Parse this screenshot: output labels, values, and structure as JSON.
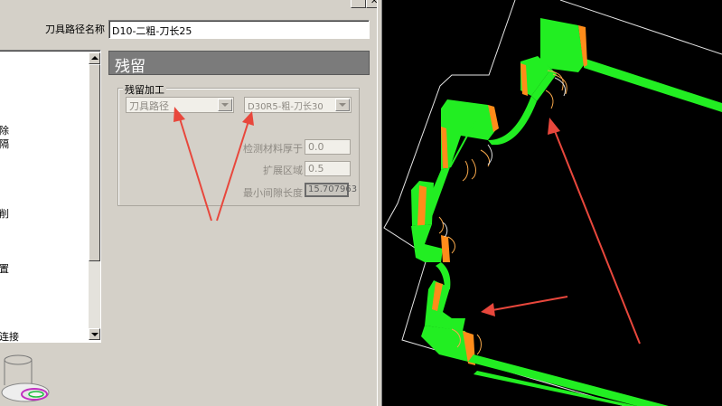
{
  "header": {
    "toolpath_name_label": "刀具路径名称",
    "toolpath_name_value": "D10-二粗-刀长25"
  },
  "section": {
    "title": "残留"
  },
  "group": {
    "title": "残留加工",
    "combo_toolpath": "刀具路径",
    "combo_tool": "D30R5-粗-刀长30",
    "rows": [
      {
        "label": "检测材料厚于",
        "value": "0.0"
      },
      {
        "label": "扩展区域",
        "value": "0.5"
      },
      {
        "label": "最小间隙长度",
        "value": "15.707963"
      }
    ]
  },
  "tree": {
    "items": [
      "除",
      "隔",
      "削",
      "置",
      "连接"
    ]
  },
  "colors": {
    "accent_green": "#22ee22",
    "accent_orange": "#ff8c1a",
    "arrow_red": "#e8473c",
    "header_bar": "#7b7b7b",
    "viewport_bg": "#000000"
  },
  "icons": [
    "close-icon",
    "scroll-up-icon",
    "scroll-down-icon",
    "combo-dropdown-icon"
  ]
}
